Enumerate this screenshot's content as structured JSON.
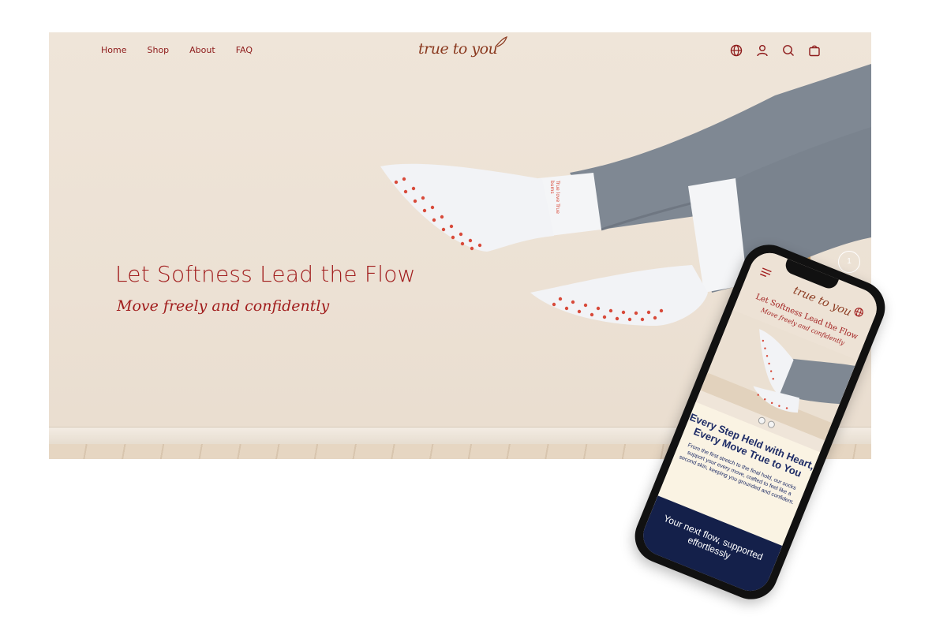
{
  "desktop": {
    "nav": {
      "items": [
        {
          "label": "Home"
        },
        {
          "label": "Shop"
        },
        {
          "label": "About"
        },
        {
          "label": "FAQ"
        }
      ]
    },
    "logo_text": "true to you",
    "header_icons": [
      "globe-icon",
      "account-icon",
      "search-icon",
      "bag-icon"
    ],
    "hero": {
      "title": "Let Softness Lead the Flow",
      "subtitle": "Move freely and confidently"
    },
    "sock_print": "True love True bums"
  },
  "phone": {
    "logo_text": "true to you",
    "hero_title": "Let Softness Lead the Flow",
    "hero_subtitle": "Move freely and confidently",
    "heading": "Every Step Held with Heart, Every Move True to You",
    "body": "From the first stretch to the final hold, our socks support your every move, crafted to feel like a second skin, keeping you grounded and confident.",
    "footer_text": "Your next flow, supported effortlessly",
    "carousel_dots": 2
  },
  "badge_number": "1",
  "colors": {
    "brand_red": "#a11d1d",
    "logo_brown": "#8b3a20",
    "navy": "#14204a",
    "heading_blue": "#1d2b66",
    "cream": "#faf3e3",
    "wall": "#ece1d4",
    "legging_gray": "#7f8893"
  }
}
